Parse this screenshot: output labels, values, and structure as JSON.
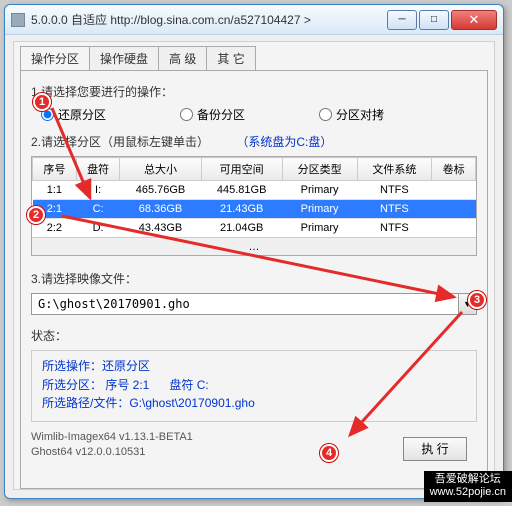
{
  "title": "5.0.0.0 自适应 http://blog.sina.com.cn/a527104427 >",
  "tabs": [
    "操作分区",
    "操作硬盘",
    "高 级",
    "其 它"
  ],
  "sec1": {
    "label": "1.请选择您要进行的操作：",
    "opts": [
      "还原分区",
      "备份分区",
      "分区对拷"
    ]
  },
  "sec2": {
    "label": "2.请选择分区（用鼠标左键单击）",
    "hint": "（系统盘为C:盘）",
    "cols": [
      "序号",
      "盘符",
      "总大小",
      "可用空间",
      "分区类型",
      "文件系统",
      "卷标"
    ],
    "rows": [
      {
        "n": "1:1",
        "d": "I:",
        "t": "465.76GB",
        "f": "445.81GB",
        "p": "Primary",
        "fs": "NTFS",
        "l": ""
      },
      {
        "n": "2:1",
        "d": "C:",
        "t": "68.36GB",
        "f": "21.43GB",
        "p": "Primary",
        "fs": "NTFS",
        "l": ""
      },
      {
        "n": "2:2",
        "d": "D:",
        "t": "43.43GB",
        "f": "21.04GB",
        "p": "Primary",
        "fs": "NTFS",
        "l": ""
      }
    ],
    "footer": "…"
  },
  "sec3": {
    "label": "3.请选择映像文件：",
    "value": "G:\\ghost\\20170901.gho"
  },
  "status": {
    "label": "状态：",
    "l1a": "所选操作：还原分区",
    "l2a": "所选分区： 序号 2:1",
    "l2b": "盘符 C:",
    "l3": "所选路径/文件：G:\\ghost\\20170901.gho"
  },
  "ver1": "Wimlib-Imagex64 v1.13.1-BETA1",
  "ver2": "Ghost64 v12.0.0.10531",
  "exec": "执 行",
  "mark": {
    "a": "吾爱破解论坛",
    "b": "www.52pojie.cn"
  }
}
